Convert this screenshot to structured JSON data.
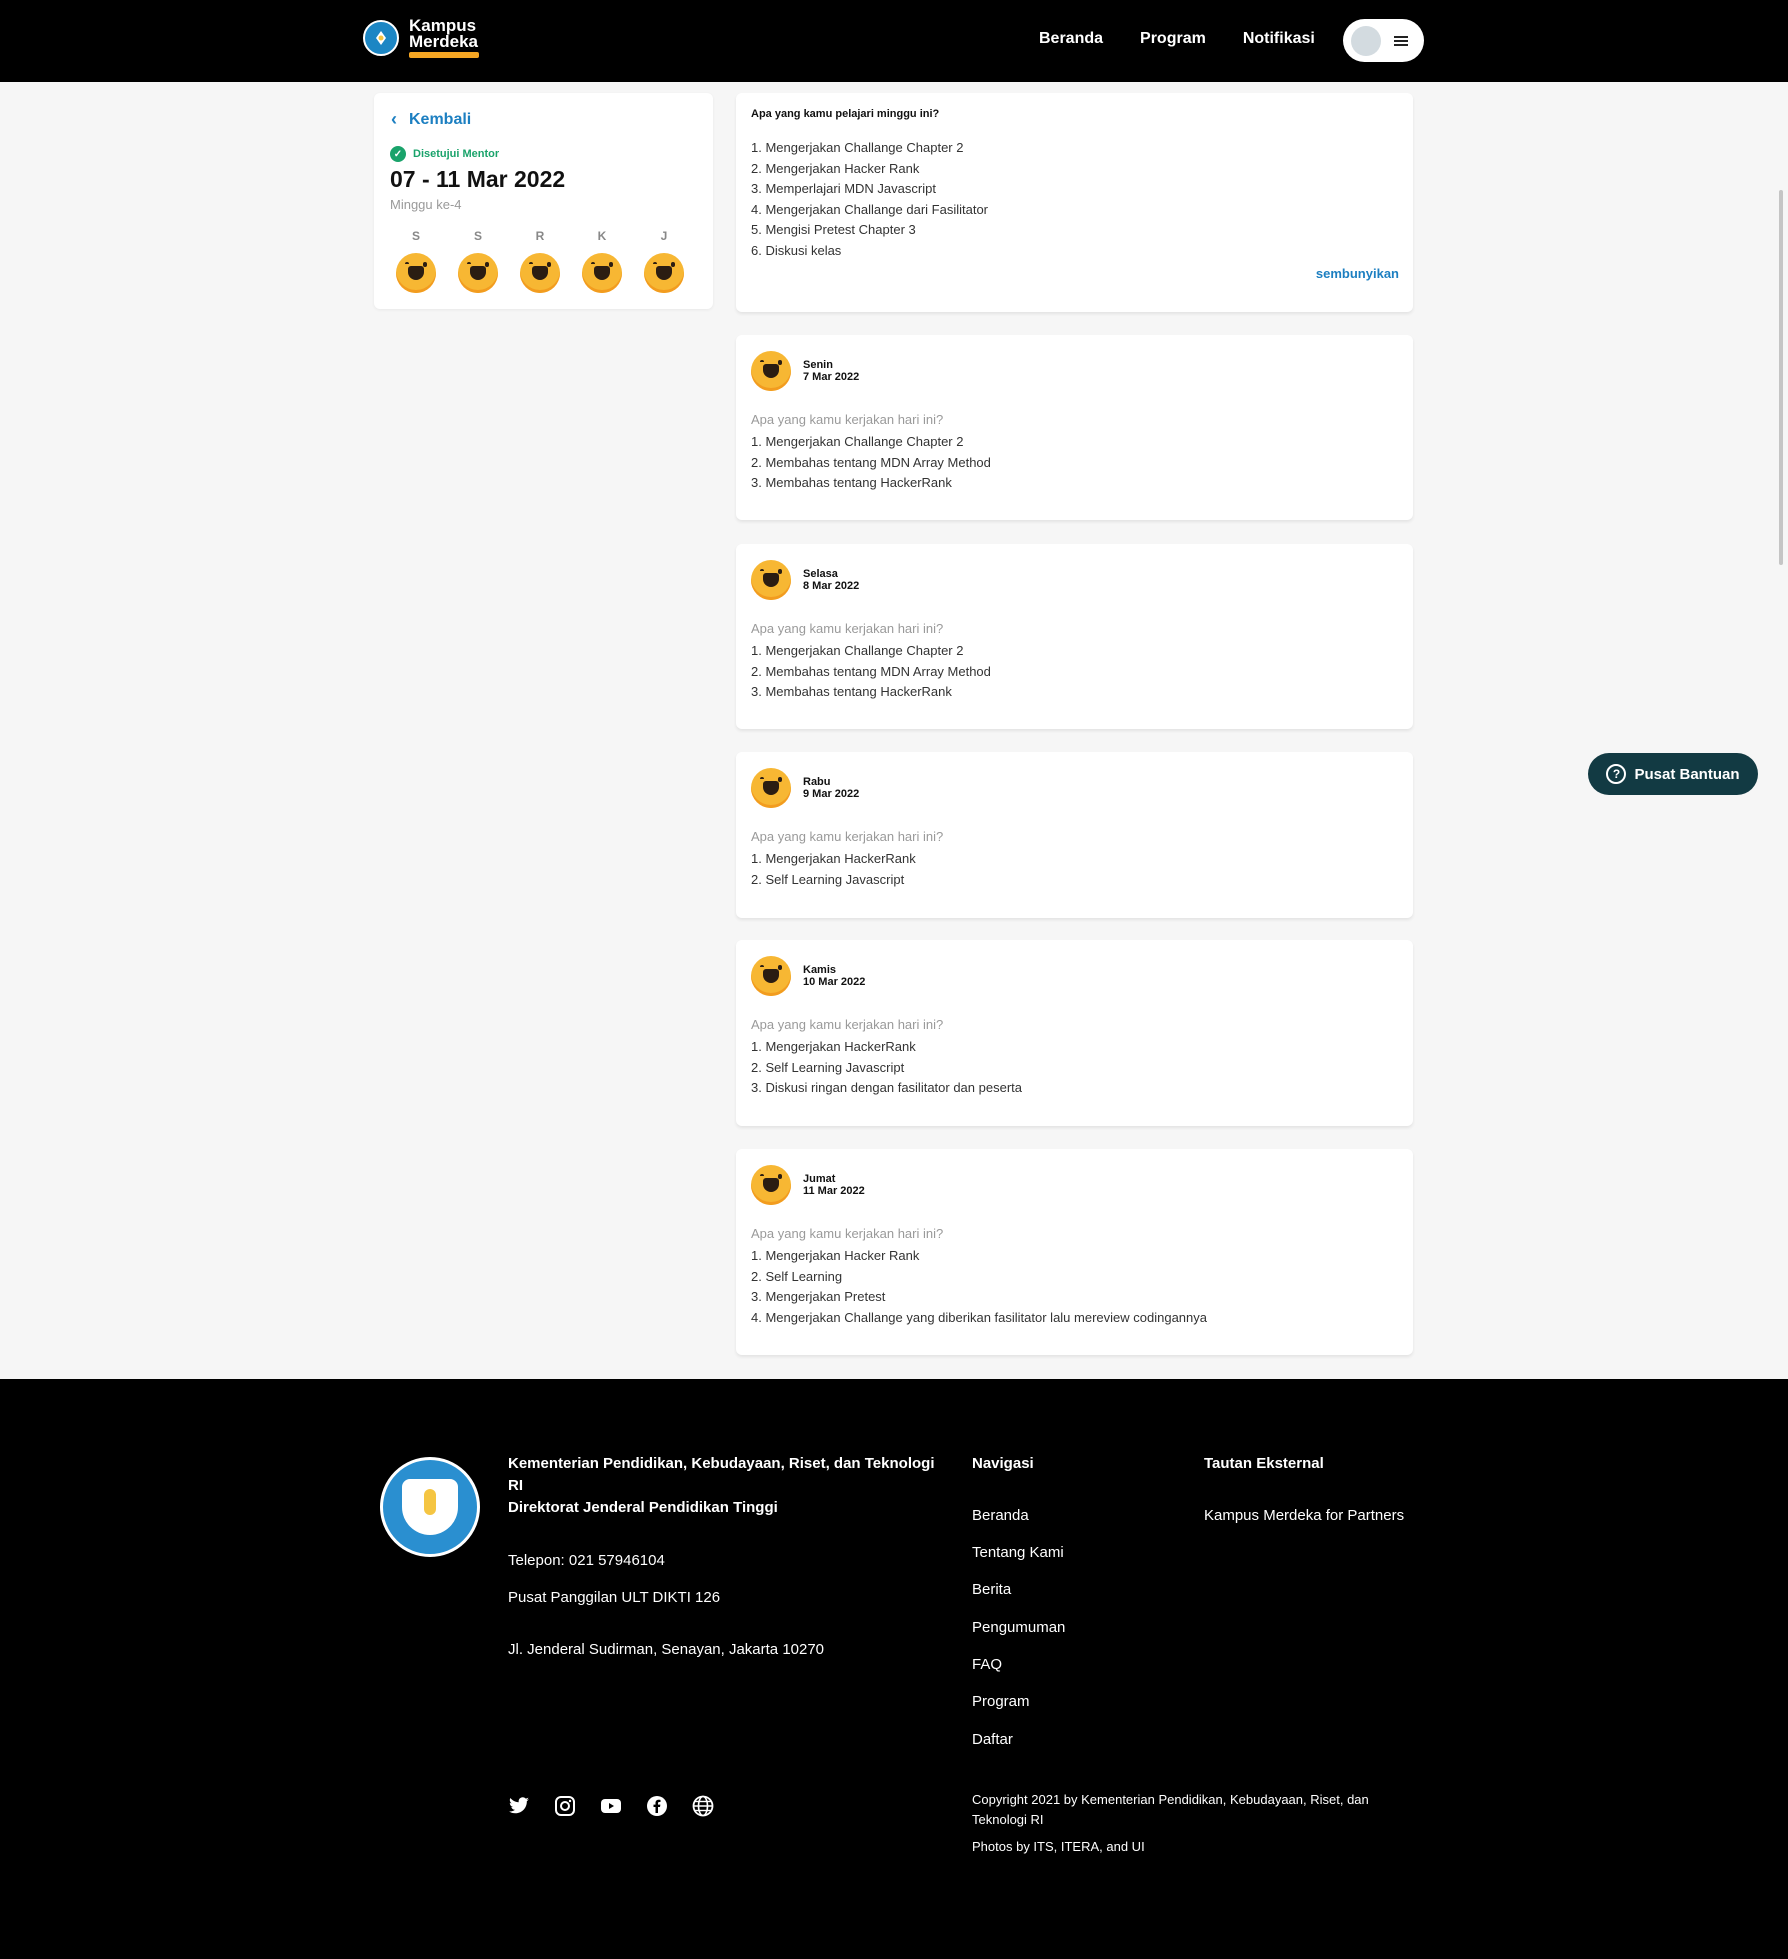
{
  "header": {
    "logo_text_1": "Kampus",
    "logo_text_2": "Merdeka",
    "nav": [
      "Beranda",
      "Program",
      "Notifikasi"
    ]
  },
  "week": {
    "back_label": "Kembali",
    "status": "Disetujui Mentor",
    "range": "07 - 11 Mar 2022",
    "week_no": "Minggu ke-4",
    "days": [
      "S",
      "S",
      "R",
      "K",
      "J"
    ]
  },
  "summary": {
    "question": "Apa yang kamu pelajari minggu ini?",
    "items": [
      "1. Mengerjakan Challange Chapter 2",
      "2. Mengerjakan Hacker Rank",
      "3. Memperlajari MDN Javascript",
      "4. Mengerjakan Challange dari Fasilitator",
      "5. Mengisi Pretest Chapter 3",
      "6. Diskusi kelas"
    ],
    "hide_label": "sembunyikan"
  },
  "daily_prompt": "Apa yang kamu kerjakan hari ini?",
  "daily": [
    {
      "day": "Senin",
      "date": "7 Mar 2022",
      "items": [
        "1. Mengerjakan Challange Chapter 2",
        "2. Membahas tentang MDN Array Method",
        "3. Membahas tentang HackerRank"
      ]
    },
    {
      "day": "Selasa",
      "date": "8 Mar 2022",
      "items": [
        "1. Mengerjakan Challange Chapter 2",
        "2. Membahas tentang MDN Array Method",
        "3. Membahas tentang HackerRank"
      ]
    },
    {
      "day": "Rabu",
      "date": "9 Mar 2022",
      "items": [
        "1. Mengerjakan HackerRank",
        "2. Self Learning Javascript"
      ]
    },
    {
      "day": "Kamis",
      "date": "10 Mar 2022",
      "items": [
        "1. Mengerjakan HackerRank",
        "2. Self Learning Javascript",
        "3. Diskusi ringan dengan fasilitator dan peserta"
      ]
    },
    {
      "day": "Jumat",
      "date": "11 Mar 2022",
      "items": [
        "1. Mengerjakan Hacker Rank",
        "2. Self Learning",
        "3. Mengerjakan Pretest",
        "4. Mengerjakan Challange yang diberikan fasilitator lalu mereview codingannya"
      ]
    }
  ],
  "help_button": "Pusat Bantuan",
  "footer": {
    "org_line1": "Kementerian Pendidikan, Kebudayaan, Riset, dan Teknologi RI",
    "org_line2": "Direktorat Jenderal Pendidikan Tinggi",
    "phone": "Telepon: 021 57946104",
    "call_center": "Pusat Panggilan ULT DIKTI 126",
    "address": "Jl. Jenderal Sudirman, Senayan, Jakarta 10270",
    "nav_title": "Navigasi",
    "nav_links": [
      "Beranda",
      "Tentang Kami",
      "Berita",
      "Pengumuman",
      "FAQ",
      "Program",
      "Daftar"
    ],
    "ext_title": "Tautan Eksternal",
    "ext_links": [
      "Kampus Merdeka for Partners"
    ],
    "copyright": "Copyright 2021 by Kementerian Pendidikan, Kebudayaan, Riset, dan Teknologi RI",
    "photos": "Photos by ITS, ITERA, and UI",
    "socials": [
      "twitter-icon",
      "instagram-icon",
      "youtube-icon",
      "facebook-icon",
      "globe-icon"
    ]
  }
}
